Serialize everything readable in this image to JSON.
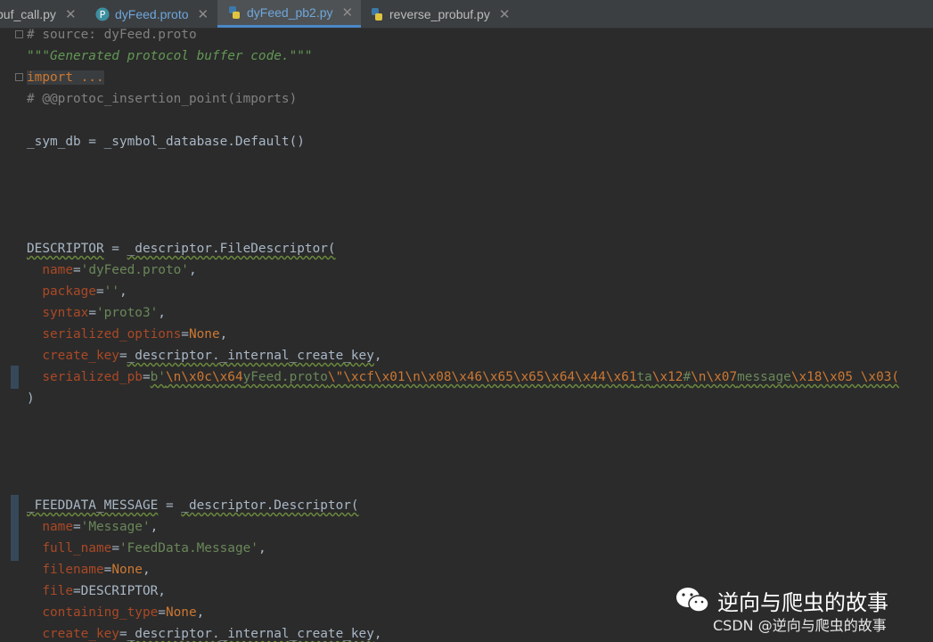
{
  "tabs": [
    {
      "label": "buf_call.py",
      "icon": "python-file-icon",
      "active": false
    },
    {
      "label": "dyFeed.proto",
      "icon": "proto-file-icon",
      "active": false
    },
    {
      "label": "dyFeed_pb2.py",
      "icon": "python-file-icon",
      "active": true
    },
    {
      "label": "reverse_probuf.py",
      "icon": "python-file-icon",
      "active": false
    }
  ],
  "close_glyph": "✕",
  "code": {
    "l1": "# source: dyFeed.proto",
    "l2": "\"\"\"Generated protocol buffer code.\"\"\"",
    "l3": "import ...",
    "l4": "# @@protoc_insertion_point(imports)",
    "l5a": "_sym_db = _symbol_database.Default()",
    "d_a": "DESCRIPTOR",
    "d_b": " = ",
    "d_c": "_descriptor.FileDescriptor(",
    "k_name": "name",
    "v_name": "'dyFeed.proto'",
    "k_package": "package",
    "v_package": "''",
    "k_syntax": "syntax",
    "v_syntax": "'proto3'",
    "k_sopts": "serialized_options",
    "v_sopts": "None",
    "k_ckey": "create_key",
    "v_ckey": "_descriptor._internal_create_key",
    "k_spb": "serialized_pb",
    "spb_parts": [
      {
        "t": "b'",
        "c": "str"
      },
      {
        "t": "\\n\\x0c\\x64",
        "c": "esc"
      },
      {
        "t": "yFeed.proto",
        "c": "str"
      },
      {
        "t": "\\\"\\xcf\\x01\\n\\x08\\x46\\x65\\x65\\x64\\x44\\x61",
        "c": "esc"
      },
      {
        "t": "ta",
        "c": "str"
      },
      {
        "t": "\\x12",
        "c": "esc"
      },
      {
        "t": "#",
        "c": "str"
      },
      {
        "t": "\\n\\x07",
        "c": "esc"
      },
      {
        "t": "message",
        "c": "str"
      },
      {
        "t": "\\x18\\x05 \\x03(",
        "c": "esc"
      }
    ],
    "close_paren": ")",
    "f_a": "_FEEDDATA_MESSAGE",
    "f_b": " = ",
    "f_c": "_descriptor.Descriptor(",
    "k_name2": "name",
    "v_name2": "'Message'",
    "k_full": "full_name",
    "v_full": "'FeedData.Message'",
    "k_filename": "filename",
    "v_filename": "None",
    "k_file": "file",
    "v_file": "DESCRIPTOR",
    "k_containing": "containing_type",
    "v_containing": "None",
    "k_ckey2": "create_key",
    "v_ckey2": "_descriptor._internal_create_key"
  },
  "watermark": {
    "top": "逆向与爬虫的故事",
    "bottom": "CSDN @逆向与爬虫的故事"
  }
}
